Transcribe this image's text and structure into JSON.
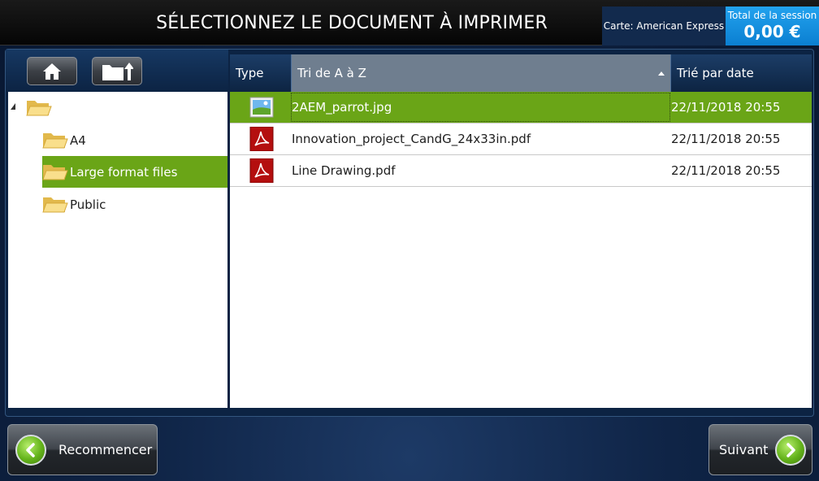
{
  "header": {
    "title": "SÉLECTIONNEZ LE DOCUMENT À IMPRIMER",
    "card_label": "Carte: American Express",
    "session_label": "Total de la session",
    "session_amount": "0,00 €"
  },
  "toolbar": {
    "home_icon": "home-icon",
    "folder_up_icon": "folder-up-icon"
  },
  "tree": {
    "root_label": "",
    "items": [
      {
        "label": "A4",
        "selected": false
      },
      {
        "label": "Large format files",
        "selected": true
      },
      {
        "label": "Public",
        "selected": false
      }
    ]
  },
  "file_list": {
    "columns": {
      "type": "Type",
      "name": "Tri de A à Z",
      "date": "Trié par date"
    },
    "rows": [
      {
        "type_icon": "image-file-icon",
        "name": "2AEM_parrot.jpg",
        "date": "22/11/2018 20:55",
        "selected": true
      },
      {
        "type_icon": "pdf-file-icon",
        "name": "Innovation_project_CandG_24x33in.pdf",
        "date": "22/11/2018 20:55",
        "selected": false
      },
      {
        "type_icon": "pdf-file-icon",
        "name": "Line Drawing.pdf",
        "date": "22/11/2018 20:55",
        "selected": false
      }
    ]
  },
  "footer": {
    "restart_label": "Recommencer",
    "next_label": "Suivant"
  },
  "colors": {
    "selection": "#6aa517",
    "session_blue": "#1a93e3",
    "header_bg": "#0d0d0d"
  }
}
